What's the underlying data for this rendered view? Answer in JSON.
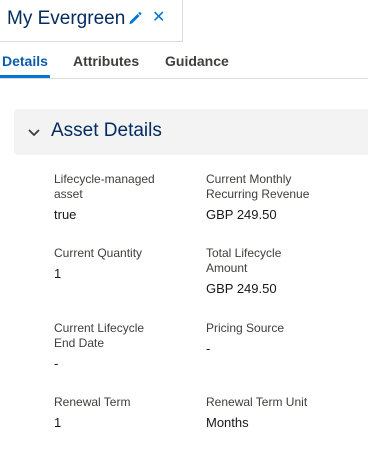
{
  "record": {
    "title": "My Evergreen"
  },
  "tabs": [
    {
      "label": "Details",
      "active": true
    },
    {
      "label": "Attributes",
      "active": false
    },
    {
      "label": "Guidance",
      "active": false
    }
  ],
  "section": {
    "title": "Asset Details",
    "fields": [
      {
        "label": "Lifecycle-managed asset",
        "value": "true"
      },
      {
        "label": "Current Monthly Recurring Revenue",
        "value": "GBP 249.50"
      },
      {
        "label": "Current Quantity",
        "value": "1"
      },
      {
        "label": "Total Lifecycle Amount",
        "value": "GBP 249.50"
      },
      {
        "label": "Current Lifecycle End Date",
        "value": "-"
      },
      {
        "label": "Pricing Source",
        "value": "-"
      },
      {
        "label": "Renewal Term",
        "value": "1"
      },
      {
        "label": "Renewal Term Unit",
        "value": "Months"
      }
    ]
  },
  "icons": {
    "edit": "pencil-icon",
    "close": "close-icon",
    "collapse": "chevron-down-icon"
  },
  "colors": {
    "brand": "#0176d3",
    "heading": "#032d60",
    "section_bg": "#f3f3f3"
  }
}
